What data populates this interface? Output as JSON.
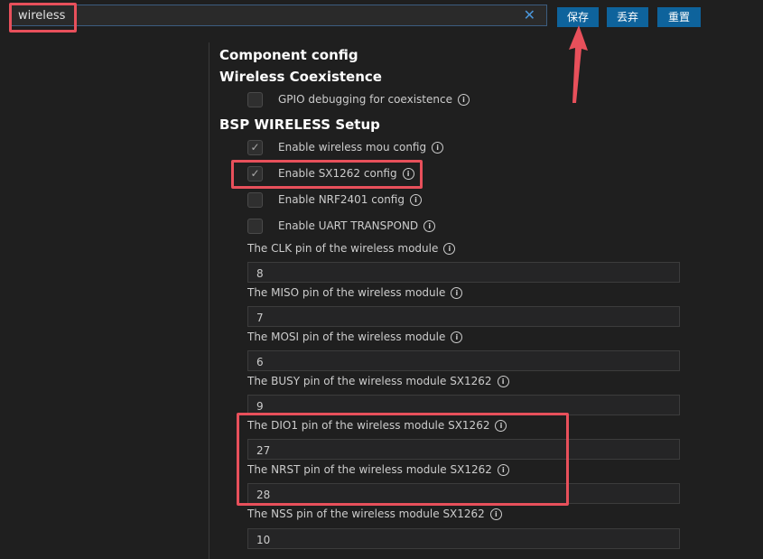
{
  "search": {
    "value": "wireless",
    "clear_icon": "✕"
  },
  "toolbar": {
    "save_label": "保存",
    "discard_label": "丢弃",
    "reset_label": "重置"
  },
  "sections": {
    "component_config": "Component config",
    "wireless_coexistence": "Wireless Coexistence",
    "bsp_wireless_setup": "BSP WIRELESS Setup"
  },
  "checkboxes": [
    {
      "label": "GPIO debugging for coexistence",
      "checked": false
    },
    {
      "label": "Enable wireless mou config",
      "checked": true
    },
    {
      "label": "Enable SX1262 config",
      "checked": true
    },
    {
      "label": "Enable NRF2401 config",
      "checked": false
    },
    {
      "label": "Enable UART TRANSPOND",
      "checked": false
    }
  ],
  "fields": [
    {
      "label": "The CLK pin of the wireless module",
      "value": "8"
    },
    {
      "label": "The MISO pin of the wireless module",
      "value": "7"
    },
    {
      "label": "The MOSI pin of the wireless module",
      "value": "6"
    },
    {
      "label": "The BUSY pin of the wireless module SX1262",
      "value": "9"
    },
    {
      "label": "The DIO1 pin of the wireless module SX1262",
      "value": "27"
    },
    {
      "label": "The NRST pin of the wireless module SX1262",
      "value": "28"
    },
    {
      "label": "The NSS pin of the wireless module SX1262",
      "value": "10"
    }
  ],
  "check_glyph": "✓",
  "info_glyph": "i",
  "colors": {
    "accent": "#0e639c",
    "highlight": "#e8505b",
    "background": "#1f1f1f"
  }
}
